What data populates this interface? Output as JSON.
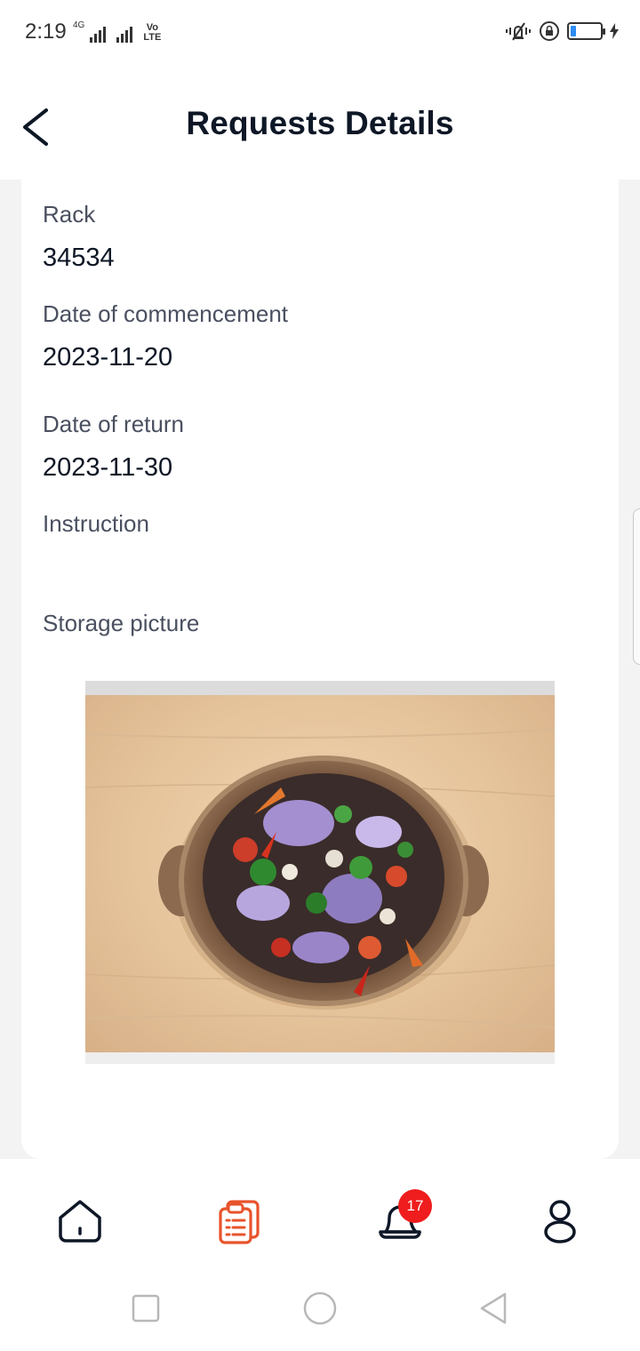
{
  "status_bar": {
    "time": "2:19",
    "network_type": "4G",
    "volte_top": "Vo",
    "volte_bottom": "LTE",
    "battery_level_percent": 20,
    "icons": [
      "signal-icon",
      "signal-icon",
      "volte-icon",
      "vibrate-icon",
      "lock-rotation-icon",
      "battery-icon",
      "charging-icon"
    ]
  },
  "header": {
    "title": "Requests Details",
    "back_icon": "chevron-left-icon"
  },
  "details": {
    "rack_label": "Rack",
    "rack_value": "34534",
    "commencement_label": "Date of commencement",
    "commencement_value": "2023-11-20",
    "return_label": "Date of return",
    "return_value": "2023-11-30",
    "instruction_label": "Instruction",
    "instruction_value": "",
    "storage_picture_label": "Storage picture"
  },
  "bottom_nav": {
    "items": [
      {
        "name": "home",
        "icon": "home-icon"
      },
      {
        "name": "requests",
        "icon": "clipboard-list-icon",
        "active": true
      },
      {
        "name": "notifications",
        "icon": "bell-icon"
      },
      {
        "name": "profile",
        "icon": "user-icon"
      }
    ],
    "notification_count": "17"
  },
  "colors": {
    "accent": "#e8532b",
    "badge": "#ef1d1d",
    "title": "#0e1726",
    "label": "#4a5060",
    "battery": "#2f8cf3"
  },
  "system_nav": {
    "icons": [
      "recent-apps-icon",
      "home-circle-icon",
      "back-triangle-icon"
    ]
  }
}
